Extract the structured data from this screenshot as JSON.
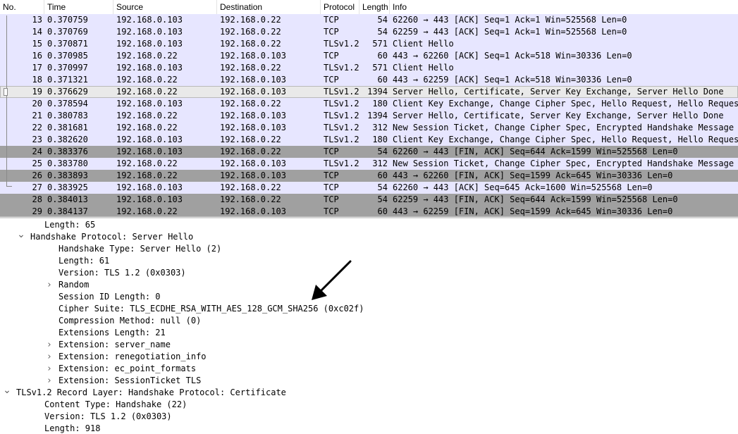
{
  "columns": [
    "No.",
    "Time",
    "Source",
    "Destination",
    "Protocol",
    "Length",
    "Info"
  ],
  "packets": [
    {
      "no": "13",
      "time": "0.370759",
      "src": "192.168.0.103",
      "dst": "192.168.0.22",
      "proto": "TCP",
      "len": "54",
      "info": "62260 → 443 [ACK] Seq=1 Ack=1 Win=525568 Len=0",
      "color": "tcp"
    },
    {
      "no": "14",
      "time": "0.370769",
      "src": "192.168.0.103",
      "dst": "192.168.0.22",
      "proto": "TCP",
      "len": "54",
      "info": "62259 → 443 [ACK] Seq=1 Ack=1 Win=525568 Len=0",
      "color": "tcp"
    },
    {
      "no": "15",
      "time": "0.370871",
      "src": "192.168.0.103",
      "dst": "192.168.0.22",
      "proto": "TLSv1.2",
      "len": "571",
      "info": "Client Hello",
      "color": "tcp"
    },
    {
      "no": "16",
      "time": "0.370985",
      "src": "192.168.0.22",
      "dst": "192.168.0.103",
      "proto": "TCP",
      "len": "60",
      "info": "443 → 62260 [ACK] Seq=1 Ack=518 Win=30336 Len=0",
      "color": "tcp"
    },
    {
      "no": "17",
      "time": "0.370997",
      "src": "192.168.0.103",
      "dst": "192.168.0.22",
      "proto": "TLSv1.2",
      "len": "571",
      "info": "Client Hello",
      "color": "tcp"
    },
    {
      "no": "18",
      "time": "0.371321",
      "src": "192.168.0.22",
      "dst": "192.168.0.103",
      "proto": "TCP",
      "len": "60",
      "info": "443 → 62259 [ACK] Seq=1 Ack=518 Win=30336 Len=0",
      "color": "tcp"
    },
    {
      "no": "19",
      "time": "0.376629",
      "src": "192.168.0.22",
      "dst": "192.168.0.103",
      "proto": "TLSv1.2",
      "len": "1394",
      "info": "Server Hello, Certificate, Server Key Exchange, Server Hello Done",
      "color": "selected"
    },
    {
      "no": "20",
      "time": "0.378594",
      "src": "192.168.0.103",
      "dst": "192.168.0.22",
      "proto": "TLSv1.2",
      "len": "180",
      "info": "Client Key Exchange, Change Cipher Spec, Hello Request, Hello Request",
      "color": "tcp"
    },
    {
      "no": "21",
      "time": "0.380783",
      "src": "192.168.0.22",
      "dst": "192.168.0.103",
      "proto": "TLSv1.2",
      "len": "1394",
      "info": "Server Hello, Certificate, Server Key Exchange, Server Hello Done",
      "color": "tcp"
    },
    {
      "no": "22",
      "time": "0.381681",
      "src": "192.168.0.22",
      "dst": "192.168.0.103",
      "proto": "TLSv1.2",
      "len": "312",
      "info": "New Session Ticket, Change Cipher Spec, Encrypted Handshake Message",
      "color": "tcp"
    },
    {
      "no": "23",
      "time": "0.382620",
      "src": "192.168.0.103",
      "dst": "192.168.0.22",
      "proto": "TLSv1.2",
      "len": "180",
      "info": "Client Key Exchange, Change Cipher Spec, Hello Request, Hello Request",
      "color": "tcp"
    },
    {
      "no": "24",
      "time": "0.383376",
      "src": "192.168.0.103",
      "dst": "192.168.0.22",
      "proto": "TCP",
      "len": "54",
      "info": "62260 → 443 [FIN, ACK] Seq=644 Ack=1599 Win=525568 Len=0",
      "color": "fin"
    },
    {
      "no": "25",
      "time": "0.383780",
      "src": "192.168.0.22",
      "dst": "192.168.0.103",
      "proto": "TLSv1.2",
      "len": "312",
      "info": "New Session Ticket, Change Cipher Spec, Encrypted Handshake Message",
      "color": "tcp"
    },
    {
      "no": "26",
      "time": "0.383893",
      "src": "192.168.0.22",
      "dst": "192.168.0.103",
      "proto": "TCP",
      "len": "60",
      "info": "443 → 62260 [FIN, ACK] Seq=1599 Ack=645 Win=30336 Len=0",
      "color": "fin"
    },
    {
      "no": "27",
      "time": "0.383925",
      "src": "192.168.0.103",
      "dst": "192.168.0.22",
      "proto": "TCP",
      "len": "54",
      "info": "62260 → 443 [ACK] Seq=645 Ack=1600 Win=525568 Len=0",
      "color": "tcp"
    },
    {
      "no": "28",
      "time": "0.384013",
      "src": "192.168.0.103",
      "dst": "192.168.0.22",
      "proto": "TCP",
      "len": "54",
      "info": "62259 → 443 [FIN, ACK] Seq=644 Ack=1599 Win=525568 Len=0",
      "color": "fin"
    },
    {
      "no": "29",
      "time": "0.384137",
      "src": "192.168.0.22",
      "dst": "192.168.0.103",
      "proto": "TCP",
      "len": "60",
      "info": "443 → 62259 [FIN, ACK] Seq=1599 Ack=645 Win=30336 Len=0",
      "color": "fin"
    }
  ],
  "details": [
    {
      "indent": 3,
      "expander": "none",
      "text": "Length: 65"
    },
    {
      "indent": 2,
      "expander": "expanded",
      "text": "Handshake Protocol: Server Hello"
    },
    {
      "indent": 4,
      "expander": "none",
      "text": "Handshake Type: Server Hello (2)"
    },
    {
      "indent": 4,
      "expander": "none",
      "text": "Length: 61"
    },
    {
      "indent": 4,
      "expander": "none",
      "text": "Version: TLS 1.2 (0x0303)"
    },
    {
      "indent": 4,
      "expander": "collapsed",
      "text": "Random"
    },
    {
      "indent": 4,
      "expander": "none",
      "text": "Session ID Length: 0"
    },
    {
      "indent": 4,
      "expander": "none",
      "text": "Cipher Suite: TLS_ECDHE_RSA_WITH_AES_128_GCM_SHA256 (0xc02f)"
    },
    {
      "indent": 4,
      "expander": "none",
      "text": "Compression Method: null (0)"
    },
    {
      "indent": 4,
      "expander": "none",
      "text": "Extensions Length: 21"
    },
    {
      "indent": 4,
      "expander": "collapsed",
      "text": "Extension: server_name"
    },
    {
      "indent": 4,
      "expander": "collapsed",
      "text": "Extension: renegotiation_info"
    },
    {
      "indent": 4,
      "expander": "collapsed",
      "text": "Extension: ec_point_formats"
    },
    {
      "indent": 4,
      "expander": "collapsed",
      "text": "Extension: SessionTicket TLS"
    },
    {
      "indent": 1,
      "expander": "expanded",
      "text": "TLSv1.2 Record Layer: Handshake Protocol: Certificate"
    },
    {
      "indent": 3,
      "expander": "none",
      "text": "Content Type: Handshake (22)"
    },
    {
      "indent": 3,
      "expander": "none",
      "text": "Version: TLS 1.2 (0x0303)"
    },
    {
      "indent": 3,
      "expander": "none",
      "text": "Length: 918"
    }
  ],
  "colors": {
    "tcp_row": "#e7e6ff",
    "fin_row": "#a0a0a0",
    "selected_row": "#e9e9e9"
  },
  "icons": {
    "expanded": "chevron-down-icon",
    "collapsed": "chevron-right-icon",
    "annotation": "arrow-icon"
  }
}
